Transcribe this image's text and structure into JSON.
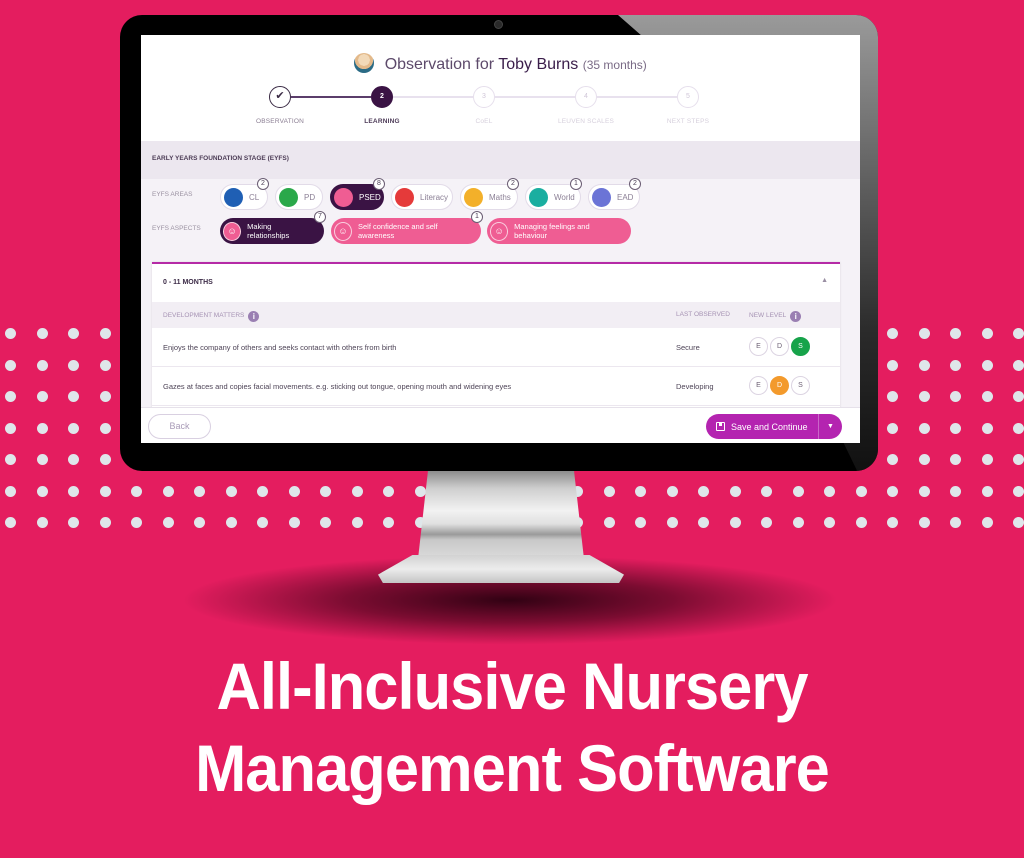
{
  "observation": {
    "prefix": "Observation for",
    "child_name": "Toby Burns",
    "age": "(35 months)"
  },
  "stepper": {
    "current_step": 2,
    "steps": [
      {
        "number": "✔",
        "label": "OBSERVATION",
        "state": "done"
      },
      {
        "number": "2",
        "label": "LEARNING",
        "state": "active"
      },
      {
        "number": "3",
        "label": "CoEL",
        "state": "pending"
      },
      {
        "number": "4",
        "label": "LEUVEN SCALES",
        "state": "pending"
      },
      {
        "number": "5",
        "label": "NEXT STEPS",
        "state": "pending"
      }
    ]
  },
  "eyfs": {
    "section_title": "EARLY YEARS FOUNDATION STAGE (EYFS)",
    "areas_label": "EYFS AREAS",
    "aspects_label": "EYFS ASPECTS",
    "areas": [
      {
        "label": "CL",
        "icon": "speech-bubble-icon",
        "color": "#1f5fb4",
        "count": "2",
        "active": false
      },
      {
        "label": "PD",
        "icon": "shirt-icon",
        "color": "#2aa84a",
        "count": "",
        "active": false
      },
      {
        "label": "PSED",
        "icon": "smiley-icon",
        "color": "#ef5d93",
        "count": "8",
        "active": true
      },
      {
        "label": "Literacy",
        "icon": "book-icon",
        "color": "#e53a3a",
        "count": "",
        "active": false
      },
      {
        "label": "Maths",
        "icon": "calculator-icon",
        "color": "#f3b02a",
        "count": "2",
        "active": false
      },
      {
        "label": "World",
        "icon": "globe-icon",
        "color": "#1aaea0",
        "count": "1",
        "active": false
      },
      {
        "label": "EAD",
        "icon": "paintbrush-icon",
        "color": "#6b74d6",
        "count": "2",
        "active": false
      }
    ],
    "aspects": [
      {
        "label": "Making relationships",
        "count": "7",
        "active": true
      },
      {
        "label": "Self confidence and self awareness",
        "count": "1",
        "active": false
      },
      {
        "label": "Managing feelings and behaviour",
        "count": "",
        "active": false
      }
    ]
  },
  "development": {
    "age_band": "0 - 11 MONTHS",
    "columns": {
      "matters": "DEVELOPMENT MATTERS",
      "last_observed": "LAST OBSERVED",
      "new_level": "NEW LEVEL"
    },
    "level_options": [
      "E",
      "D",
      "S"
    ],
    "rows": [
      {
        "description": "Enjoys the company of others and seeks contact with others from birth",
        "last_observed": "Secure",
        "selected": "S"
      },
      {
        "description": "Gazes at faces and copies facial movements. e.g. sticking out tongue, opening mouth and widening eyes",
        "last_observed": "Developing",
        "selected": "D"
      }
    ]
  },
  "footer": {
    "back_label": "Back",
    "save_label": "Save and Continue"
  },
  "headline": {
    "line1": "All-Inclusive Nursery",
    "line2": "Management Software"
  },
  "colors": {
    "background": "#e41d5f",
    "accent_purple": "#b424b0",
    "dark_purple": "#3a1344",
    "pink": "#ef5d93",
    "secure_green": "#17a34a",
    "developing_orange": "#f39a2c"
  }
}
